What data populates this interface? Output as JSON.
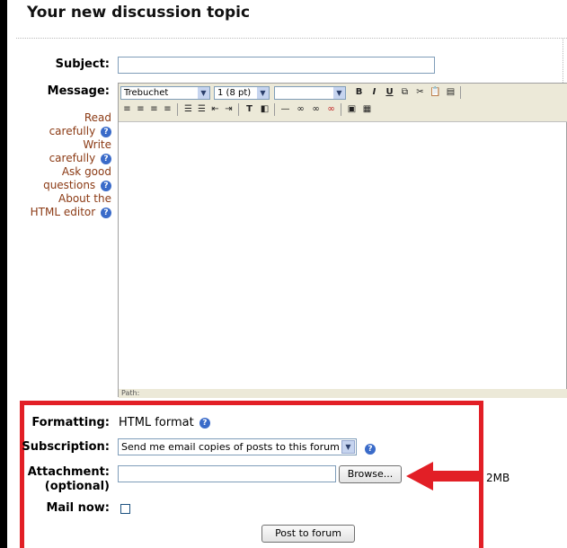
{
  "page": {
    "heading": "Your new discussion topic"
  },
  "form": {
    "subject_label": "Subject:",
    "subject_value": "",
    "message_label": "Message:",
    "help_links": [
      {
        "label": "Read carefully",
        "icon": "help-icon"
      },
      {
        "label": "Write carefully",
        "icon": "help-icon"
      },
      {
        "label": "Ask good questions",
        "icon": "help-icon"
      },
      {
        "label": "About the HTML editor",
        "icon": "help-icon"
      }
    ],
    "editor": {
      "font_family": "Trebuchet",
      "font_size": "1 (8 pt)",
      "heading_select": "",
      "path_label": "Path:"
    },
    "formatting_label": "Formatting:",
    "formatting_value": "HTML format",
    "subscription_label": "Subscription:",
    "subscription_value": "Send me email copies of posts to this forum",
    "attachment_label": "Attachment:",
    "attachment_sublabel": "(optional)",
    "attachment_value": "",
    "browse_label": "Browse...",
    "max_size": "2MB",
    "mail_now_label": "Mail now:",
    "mail_now_checked": false,
    "submit_label": "Post to forum"
  },
  "colors": {
    "highlight": "#e21f26",
    "link": "#8b3a14"
  }
}
